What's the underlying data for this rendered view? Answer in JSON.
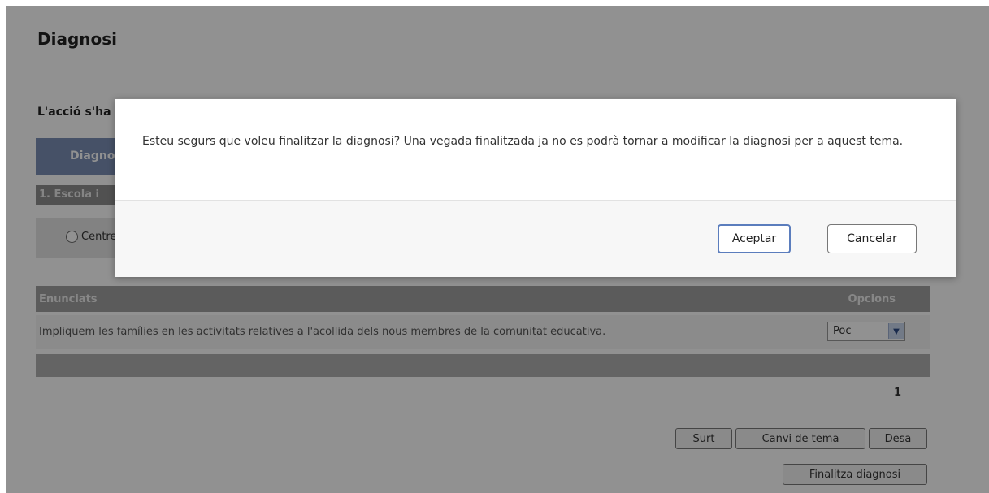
{
  "page": {
    "title": "Diagnosi",
    "status_text": "L'acció s'ha",
    "section_header": "Diagnosi",
    "topic": "1. Escola i",
    "radio_option": "Centre"
  },
  "table": {
    "headers": [
      "Enunciats",
      "Opcions"
    ],
    "rows": [
      {
        "statement": "Impliquem les famílies en les activitats relatives a l'acollida dels nous membres de la comunitat educativa.",
        "option": "Poc"
      }
    ]
  },
  "pagination": {
    "current_page": "1"
  },
  "buttons": {
    "exit": "Surt",
    "change_topic": "Canvi de tema",
    "save": "Desa",
    "finish": "Finalitza diagnosi"
  },
  "dialog": {
    "message": "Esteu segurs que voleu finalitzar la diagnosi? Una vegada finalitzada ja no es podrà tornar a modificar la diagnosi per a aquest tema.",
    "accept_label": "Aceptar",
    "cancel_label": "Cancelar"
  },
  "colors": {
    "section_header": "#7b8fb6",
    "overlay": "#000000",
    "accept_border": "#5b7dbd"
  }
}
